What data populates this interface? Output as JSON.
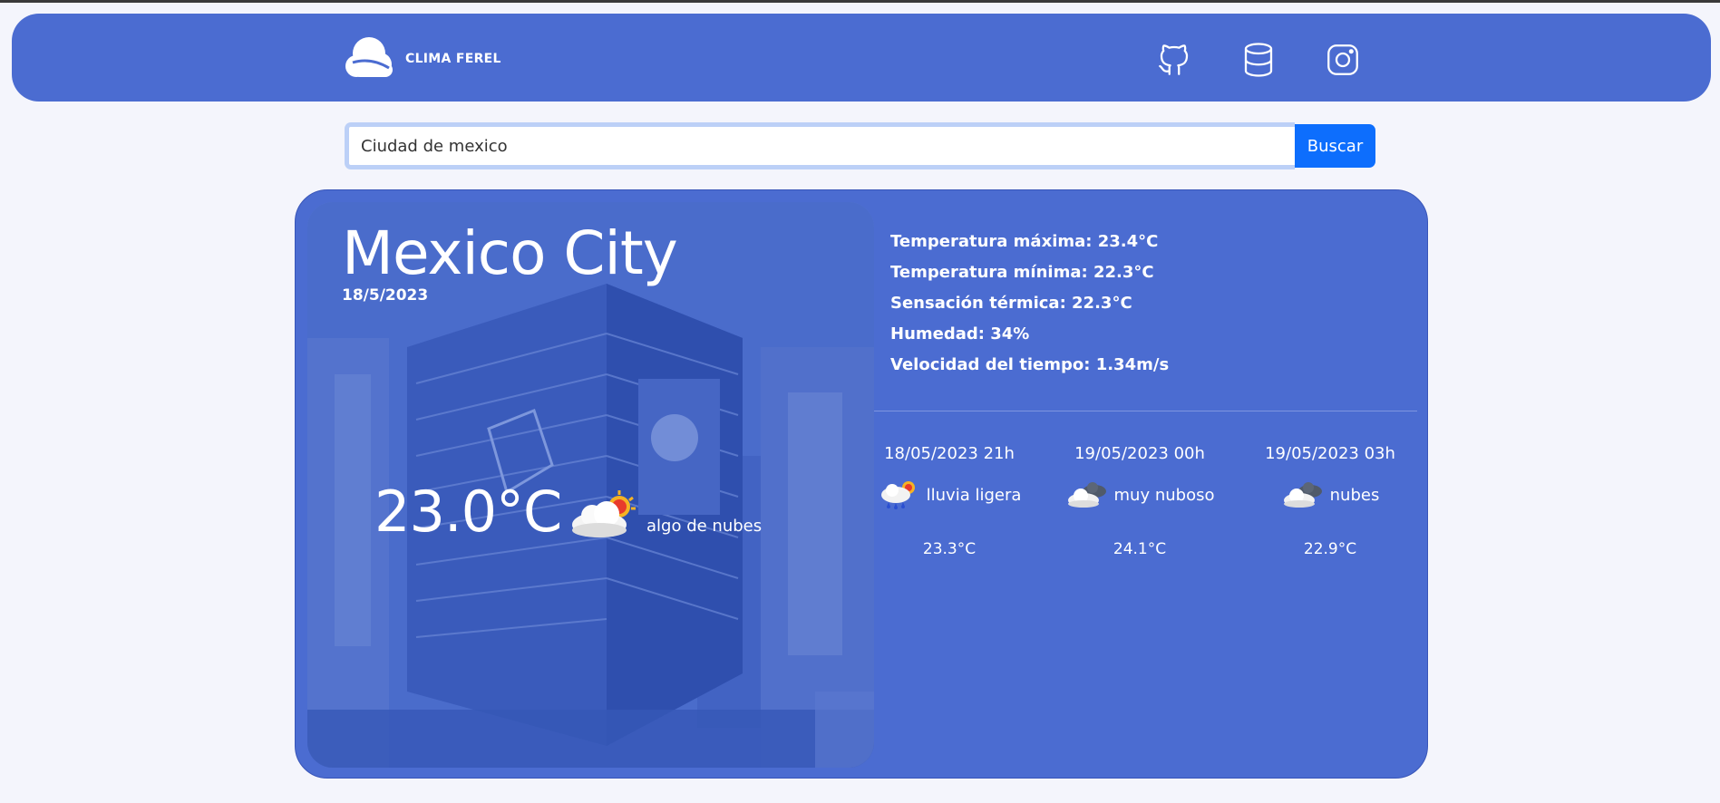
{
  "brand": {
    "name": "CLIMA FEREL",
    "logo_icon": "cloud-logo-icon"
  },
  "nav_icons": [
    "github-icon",
    "database-icon",
    "instagram-icon"
  ],
  "search": {
    "value": "Ciudad de mexico",
    "button_label": "Buscar"
  },
  "current": {
    "city": "Mexico City",
    "date": "18/5/2023",
    "temperature": "23.0°C",
    "description": "algo de nubes",
    "icon": "sun-behind-cloud-icon"
  },
  "details": [
    "Temperatura máxima: 23.4°C",
    "Temperatura mínima: 22.3°C",
    "Sensación térmica: 22.3°C",
    "Humedad: 34%",
    "Velocidad del tiempo: 1.34m/s"
  ],
  "forecast": [
    {
      "time": "18/05/2023 21h",
      "description": "lluvia ligera",
      "temp": "23.3°C",
      "icon": "rain-cloud-icon"
    },
    {
      "time": "19/05/2023 00h",
      "description": "muy nuboso",
      "temp": "24.1°C",
      "icon": "dark-cloud-icon"
    },
    {
      "time": "19/05/2023 03h",
      "description": "nubes",
      "temp": "22.9°C",
      "icon": "dark-cloud-icon"
    }
  ],
  "colors": {
    "navbar": "#4b6cd1",
    "card": "#4b6cd1",
    "button": "#0d6efd",
    "background": "#f4f5fc"
  }
}
